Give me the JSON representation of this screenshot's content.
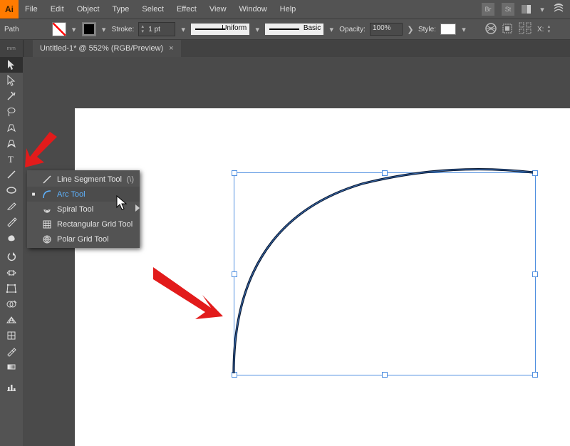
{
  "menubar": {
    "items": [
      "File",
      "Edit",
      "Object",
      "Type",
      "Select",
      "Effect",
      "View",
      "Window",
      "Help"
    ],
    "right_btns": [
      "Br",
      "St"
    ]
  },
  "ctrlbar": {
    "mode_label": "Path",
    "stroke_label": "Stroke:",
    "stroke_weight": "1 pt",
    "line_profile": "Uniform",
    "brush_profile": "Basic",
    "opacity_label": "Opacity:",
    "opacity_value": "100%",
    "style_label": "Style:",
    "x_label": "X:"
  },
  "tab": {
    "title": "Untitled-1* @ 552% (RGB/Preview)"
  },
  "flyout": {
    "items": [
      {
        "label": "Line Segment Tool",
        "shortcut": "(\\)",
        "sel": false,
        "icon": "line"
      },
      {
        "label": "Arc Tool",
        "shortcut": "",
        "sel": true,
        "icon": "arc"
      },
      {
        "label": "Spiral Tool",
        "shortcut": "",
        "sel": false,
        "icon": "spiral"
      },
      {
        "label": "Rectangular Grid Tool",
        "shortcut": "",
        "sel": false,
        "icon": "grid"
      },
      {
        "label": "Polar Grid Tool",
        "shortcut": "",
        "sel": false,
        "icon": "polar"
      }
    ]
  }
}
